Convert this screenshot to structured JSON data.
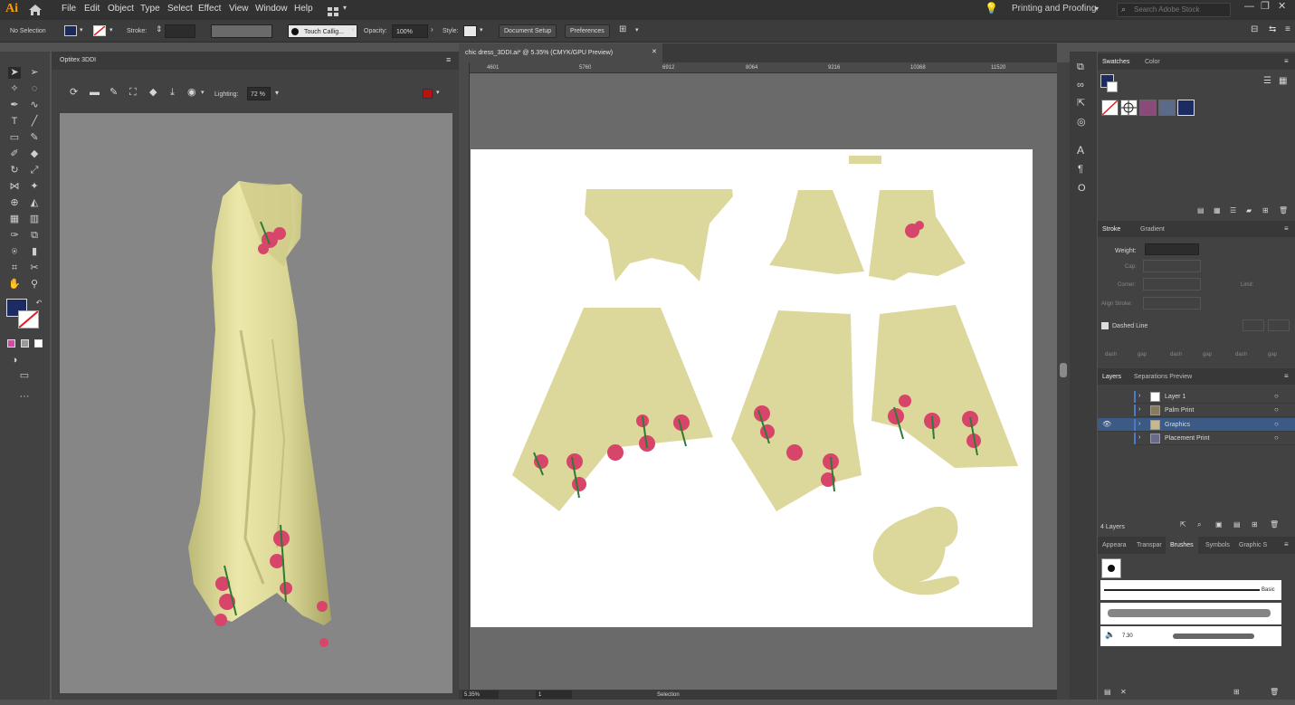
{
  "app": {
    "icon": "Ai",
    "home_icon": "home-icon"
  },
  "menu": [
    "File",
    "Edit",
    "Object",
    "Type",
    "Select",
    "Effect",
    "View",
    "Window",
    "Help"
  ],
  "workspace": "Printing and Proofing",
  "search_placeholder": "Search Adobe Stock",
  "control": {
    "selection": "No Selection",
    "stroke_label": "Stroke:",
    "brush": "Touch Callig...",
    "opacity_label": "Opacity:",
    "opacity": "100%",
    "style_label": "Style:",
    "doc_setup": "Document Setup",
    "preferences": "Preferences"
  },
  "panel3d": {
    "title": "Optitex 3DDI",
    "lighting_label": "Lighting:",
    "lighting": "72 %"
  },
  "document": {
    "tab": "chic dress_3DDI.ai* @ 5.35% (CMYK/GPU Preview)",
    "close": "✕",
    "ruler_ticks": [
      "4601",
      "5760",
      "6912",
      "8064",
      "9216",
      "10368",
      "11520"
    ],
    "zoom": "5.35%",
    "artboard": "1",
    "status": "Selection"
  },
  "swatches": {
    "tabs": [
      "Swatches",
      "Color"
    ]
  },
  "stroke": {
    "tabs": [
      "Stroke",
      "Gradient"
    ],
    "weight_label": "Weight:",
    "cap": "Cap:",
    "corner": "Corner:",
    "align": "Align Stroke:",
    "limit": "Limit:",
    "dashed": "Dashed Line",
    "dash_cells": [
      "dash",
      "gap",
      "dash",
      "gap",
      "dash",
      "gap"
    ]
  },
  "layers": {
    "tabs": [
      "Layers",
      "Separations Preview"
    ],
    "items": [
      "Layer 1",
      "Palm Print",
      "Graphics",
      "Placement Print"
    ],
    "count": "4 Layers"
  },
  "brushes": {
    "tabs": [
      "Appeara",
      "Transpar",
      "Brushes",
      "Symbols",
      "Graphic S"
    ],
    "basic": "Basic",
    "size": "7.30"
  },
  "colors": {
    "fabric": "#dcd79b",
    "flower": "#d8456a",
    "leaf": "#2f7a34",
    "selected_layer": "#3c5a86",
    "accent": "#ff9a00"
  }
}
